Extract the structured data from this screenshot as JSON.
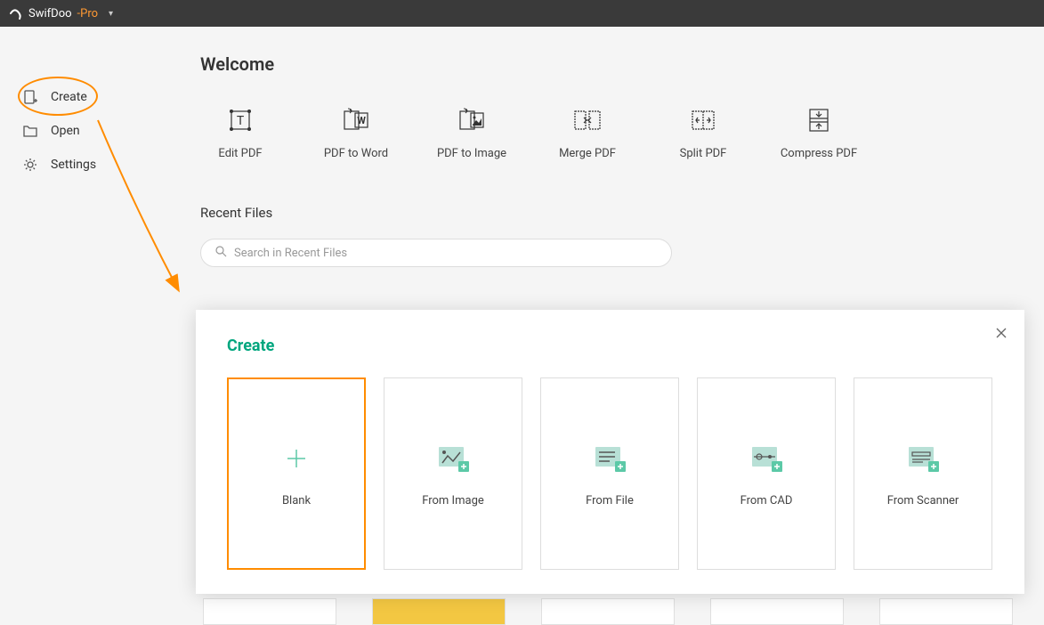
{
  "titlebar": {
    "app_name": "SwifDoo",
    "app_suffix": "-Pro"
  },
  "sidebar": {
    "items": [
      {
        "label": "Create",
        "icon": "create-doc-icon"
      },
      {
        "label": "Open",
        "icon": "open-folder-icon"
      },
      {
        "label": "Settings",
        "icon": "gear-icon"
      }
    ]
  },
  "main": {
    "welcome_title": "Welcome",
    "tools": [
      {
        "label": "Edit PDF",
        "icon": "edit-pdf-icon"
      },
      {
        "label": "PDF to Word",
        "icon": "pdf-word-icon"
      },
      {
        "label": "PDF to Image",
        "icon": "pdf-image-icon"
      },
      {
        "label": "Merge PDF",
        "icon": "merge-pdf-icon"
      },
      {
        "label": "Split PDF",
        "icon": "split-pdf-icon"
      },
      {
        "label": "Compress PDF",
        "icon": "compress-pdf-icon"
      }
    ],
    "recent_title": "Recent Files",
    "search_placeholder": "Search in Recent Files"
  },
  "create_modal": {
    "title": "Create",
    "options": [
      {
        "label": "Blank",
        "icon": "plus-icon",
        "active": true
      },
      {
        "label": "From Image",
        "icon": "from-image-icon",
        "active": false
      },
      {
        "label": "From File",
        "icon": "from-file-icon",
        "active": false
      },
      {
        "label": "From CAD",
        "icon": "from-cad-icon",
        "active": false
      },
      {
        "label": "From Scanner",
        "icon": "from-scanner-icon",
        "active": false
      }
    ]
  },
  "colors": {
    "accent_orange": "#ff8c00",
    "accent_green": "#00a67e",
    "titlebar_bg": "#3a3a3a"
  }
}
